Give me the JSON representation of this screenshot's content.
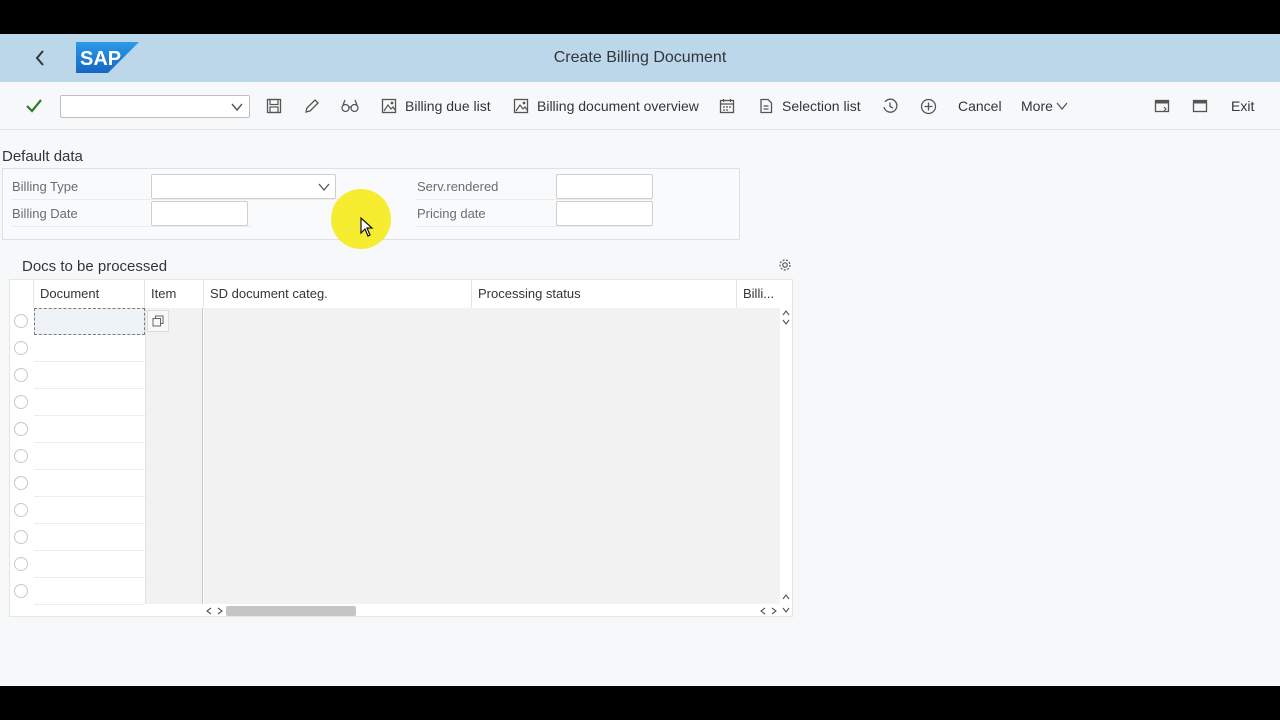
{
  "shell": {
    "title": "Create Billing Document",
    "logo_text": "SAP",
    "colors": {
      "header_bg": "#bcd6ea",
      "logo": "#1a7fd0",
      "check": "#2b7d2b"
    }
  },
  "toolbar": {
    "command_field": {
      "value": "",
      "placeholder": ""
    },
    "billing_due_list": "Billing due list",
    "billing_document_overview": "Billing document overview",
    "selection_list": "Selection list",
    "cancel": "Cancel",
    "more": "More",
    "exit": "Exit"
  },
  "default_data": {
    "title": "Default data",
    "billing_type": {
      "label": "Billing Type",
      "value": ""
    },
    "billing_date": {
      "label": "Billing Date",
      "value": ""
    },
    "serv_rendered": {
      "label": "Serv.rendered",
      "value": ""
    },
    "pricing_date": {
      "label": "Pricing date",
      "value": ""
    }
  },
  "docs_table": {
    "title": "Docs to be processed",
    "columns": [
      "Document",
      "Item",
      "SD document categ.",
      "Processing status",
      "Billi..."
    ],
    "row_count": 11
  }
}
